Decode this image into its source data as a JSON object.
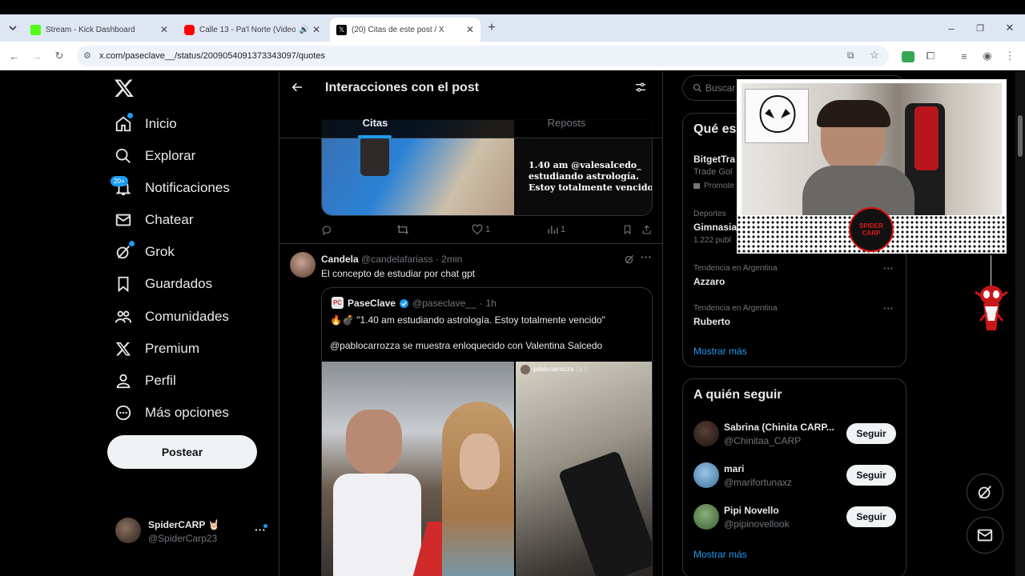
{
  "browser": {
    "tabs": [
      {
        "title": "Stream - Kick Dashboard",
        "favicon_color": "#53fc18"
      },
      {
        "title": "Calle 13 - Pa'l Norte (Video",
        "favicon_color": "#ff0000"
      },
      {
        "title": "(20) Citas de este post / X",
        "favicon_color": "#000000"
      }
    ],
    "url": "x.com/paseclave__/status/2009054091373343097/quotes"
  },
  "sidebar": {
    "logo": "X",
    "items": [
      {
        "label": "Inicio",
        "icon": "home-icon"
      },
      {
        "label": "Explorar",
        "icon": "search-icon"
      },
      {
        "label": "Notificaciones",
        "icon": "bell-icon",
        "badge": "20+"
      },
      {
        "label": "Chatear",
        "icon": "mail-icon"
      },
      {
        "label": "Grok",
        "icon": "grok-icon"
      },
      {
        "label": "Guardados",
        "icon": "bookmark-icon"
      },
      {
        "label": "Comunidades",
        "icon": "communities-icon"
      },
      {
        "label": "Premium",
        "icon": "x-icon"
      },
      {
        "label": "Perfil",
        "icon": "person-icon"
      },
      {
        "label": "Más opciones",
        "icon": "more-icon"
      }
    ],
    "post_button": "Postear",
    "account": {
      "name": "SpiderCARP",
      "emoji": "🤘🏻",
      "handle": "@SpiderCarp23"
    }
  },
  "center": {
    "title": "Interacciones con el post",
    "tabs": [
      "Citas",
      "Reposts"
    ],
    "prev_media_caption": [
      "1.40 am @valesalcedo_",
      "estudiando astrología.",
      "Estoy totalmente vencido."
    ],
    "prev_actions": {
      "replies": "",
      "reposts": "",
      "likes": "1",
      "views": "1"
    },
    "post": {
      "author": "Candela",
      "handle": "@candelafariass",
      "sep": "·",
      "time": "2min",
      "text": "El concepto de estudiar por chat gpt",
      "quote": {
        "author": "PaseClave",
        "handle": "@paseclave__",
        "sep": "·",
        "time": "1h",
        "line1": "🔥💣 \"1.40 am estudiando astrología. Estoy totalmente vencido\"",
        "line2": "@pablocarrozza se muestra enloquecido con Valentina Salcedo",
        "media_overlay_user": "pablocarrozza",
        "media_overlay_time": "19 h"
      }
    }
  },
  "right": {
    "search_placeholder": "Buscar",
    "whats_happening": {
      "title": "Qué es",
      "items": [
        {
          "title": "BitgetTra",
          "sub": "Trade Gol",
          "promo": "Promote"
        },
        {
          "context": "Deportes",
          "title": "Gimnasia",
          "count": "1.222 publ"
        },
        {
          "context": "Tendencia en Argentina",
          "title": "Azzaro"
        },
        {
          "context": "Tendencia en Argentina",
          "title": "Ruberto"
        }
      ],
      "more": "Mostrar más"
    },
    "who_to_follow": {
      "title": "A quién seguir",
      "users": [
        {
          "name": "Sabrina (Chinita CARP...",
          "handle": "@Chinitaa_CARP",
          "button": "Seguir"
        },
        {
          "name": "mari",
          "handle": "@marifortunaxz",
          "button": "Seguir"
        },
        {
          "name": "Pipi Novello",
          "handle": "@pipinovellook",
          "button": "Seguir"
        }
      ],
      "more": "Mostrar más"
    }
  },
  "webcam": {
    "logo_text": "SPIDER CARP"
  },
  "colors": {
    "accent": "#1d9bf0",
    "bg": "#000000",
    "border": "#2f3336",
    "muted": "#71767b"
  }
}
